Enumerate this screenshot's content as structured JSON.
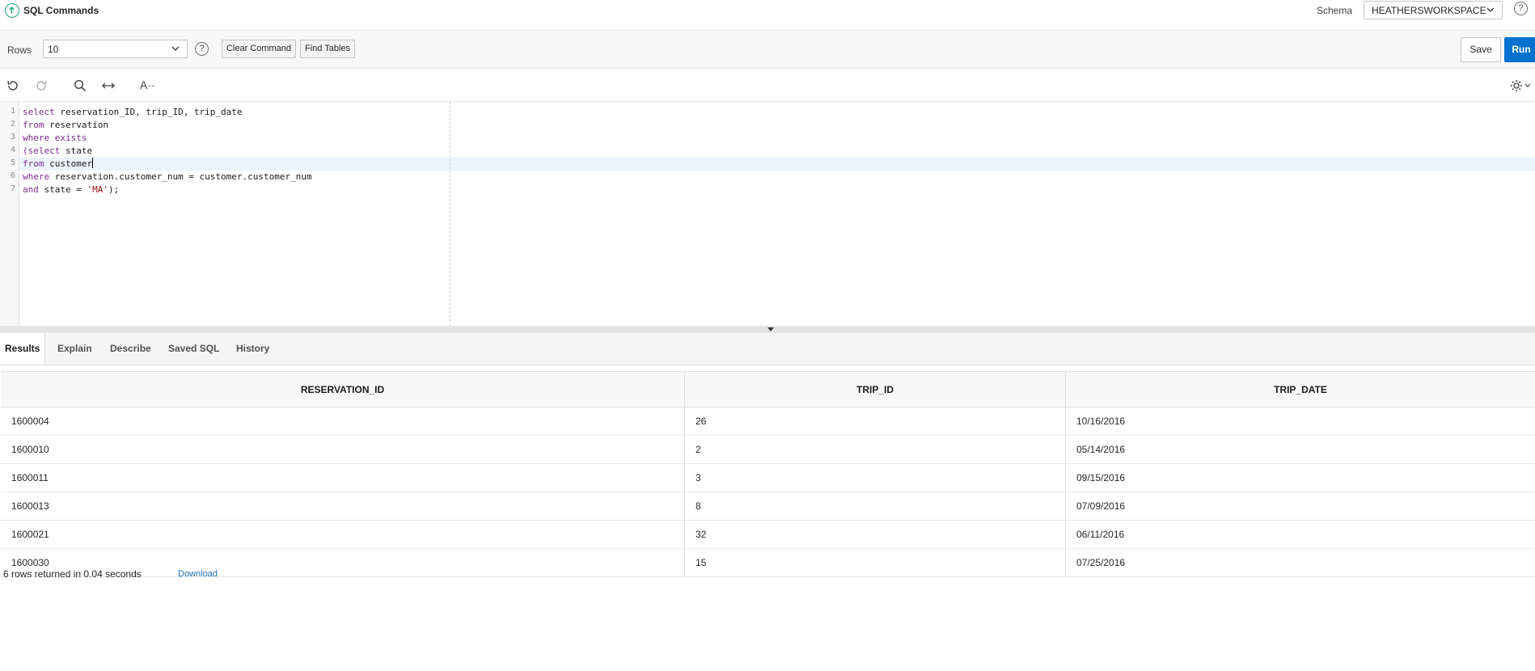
{
  "header": {
    "title": "SQL Commands",
    "schema_label": "Schema",
    "schema_value": "HEATHERSWORKSPACE",
    "help_glyph": "?"
  },
  "toolbar": {
    "rows_label": "Rows",
    "rows_value": "10",
    "help_glyph": "?",
    "clear_label": "Clear Command",
    "find_label": "Find Tables",
    "save_label": "Save",
    "run_label": "Run"
  },
  "editor": {
    "font_icon_text": "A··",
    "line_numbers": [
      "1",
      "2",
      "3",
      "4",
      "5",
      "6",
      "7"
    ]
  },
  "tabs": [
    {
      "label": "Results"
    },
    {
      "label": "Explain"
    },
    {
      "label": "Describe"
    },
    {
      "label": "Saved SQL"
    },
    {
      "label": "History"
    }
  ],
  "results": {
    "columns": [
      "RESERVATION_ID",
      "TRIP_ID",
      "TRIP_DATE"
    ],
    "rows": [
      [
        "1600004",
        "26",
        "10/16/2016"
      ],
      [
        "1600010",
        "2",
        "05/14/2016"
      ],
      [
        "1600011",
        "3",
        "09/15/2016"
      ],
      [
        "1600013",
        "8",
        "07/09/2016"
      ],
      [
        "1600021",
        "32",
        "06/11/2016"
      ],
      [
        "1600030",
        "15",
        "07/25/2016"
      ]
    ],
    "status": "6 rows returned in 0.04 seconds",
    "download_label": "Download"
  },
  "code": {
    "l1_kw": "select",
    "l1_rest": " reservation_ID, trip_ID, trip_date",
    "l2_kw": "from",
    "l2_rest": " reservation",
    "l3_kw": "where exists",
    "l4_kw": "(select",
    "l4_rest": " state",
    "l5_kw": "from",
    "l5_rest": " customer",
    "l6_kw": "where",
    "l6_rest": " reservation.customer_num = customer.customer_num",
    "l7_kw": "and",
    "l7_rest": " state = ",
    "l7_str": "'MA'",
    "l7_end": ");"
  },
  "colors": {
    "accent": "#0572ce",
    "logo": "#1aa37a",
    "keyword": "#7a2a8c",
    "string": "#a31515"
  }
}
